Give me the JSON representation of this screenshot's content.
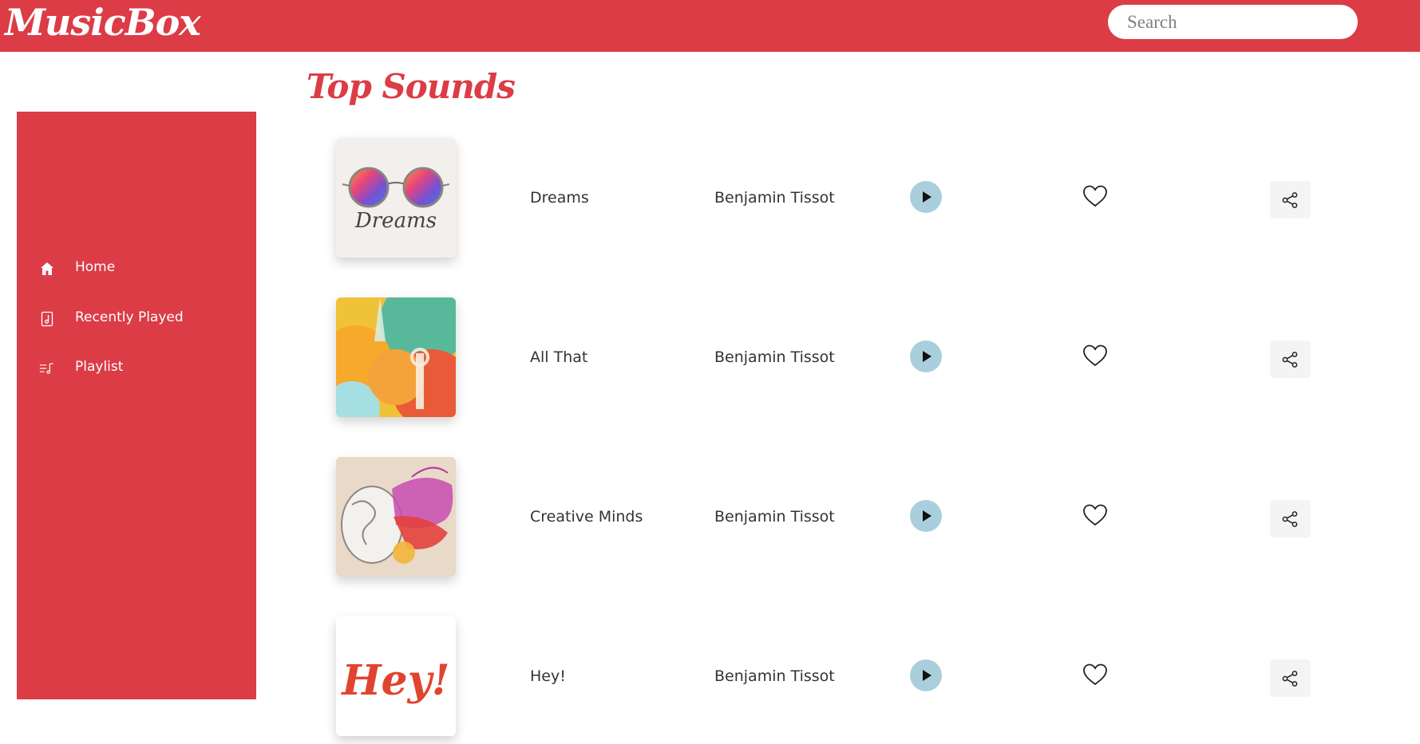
{
  "header": {
    "logo": "MusicBox",
    "search_placeholder": "Search"
  },
  "sidebar": {
    "items": [
      {
        "label": "Home",
        "icon": "home-icon"
      },
      {
        "label": "Recently Played",
        "icon": "music-note-icon"
      },
      {
        "label": "Playlist",
        "icon": "playlist-icon"
      }
    ]
  },
  "main": {
    "title": "Top Sounds",
    "tracks": [
      {
        "title": "Dreams",
        "artist": "Benjamin Tissot",
        "cover_text": "Dreams"
      },
      {
        "title": "All That",
        "artist": "Benjamin Tissot"
      },
      {
        "title": "Creative Minds",
        "artist": "Benjamin Tissot"
      },
      {
        "title": "Hey!",
        "artist": "Benjamin Tissot",
        "cover_text": "Hey!"
      }
    ]
  },
  "colors": {
    "brand": "#db3c46",
    "play_button": "#a9cfdc",
    "text": "#333333"
  }
}
